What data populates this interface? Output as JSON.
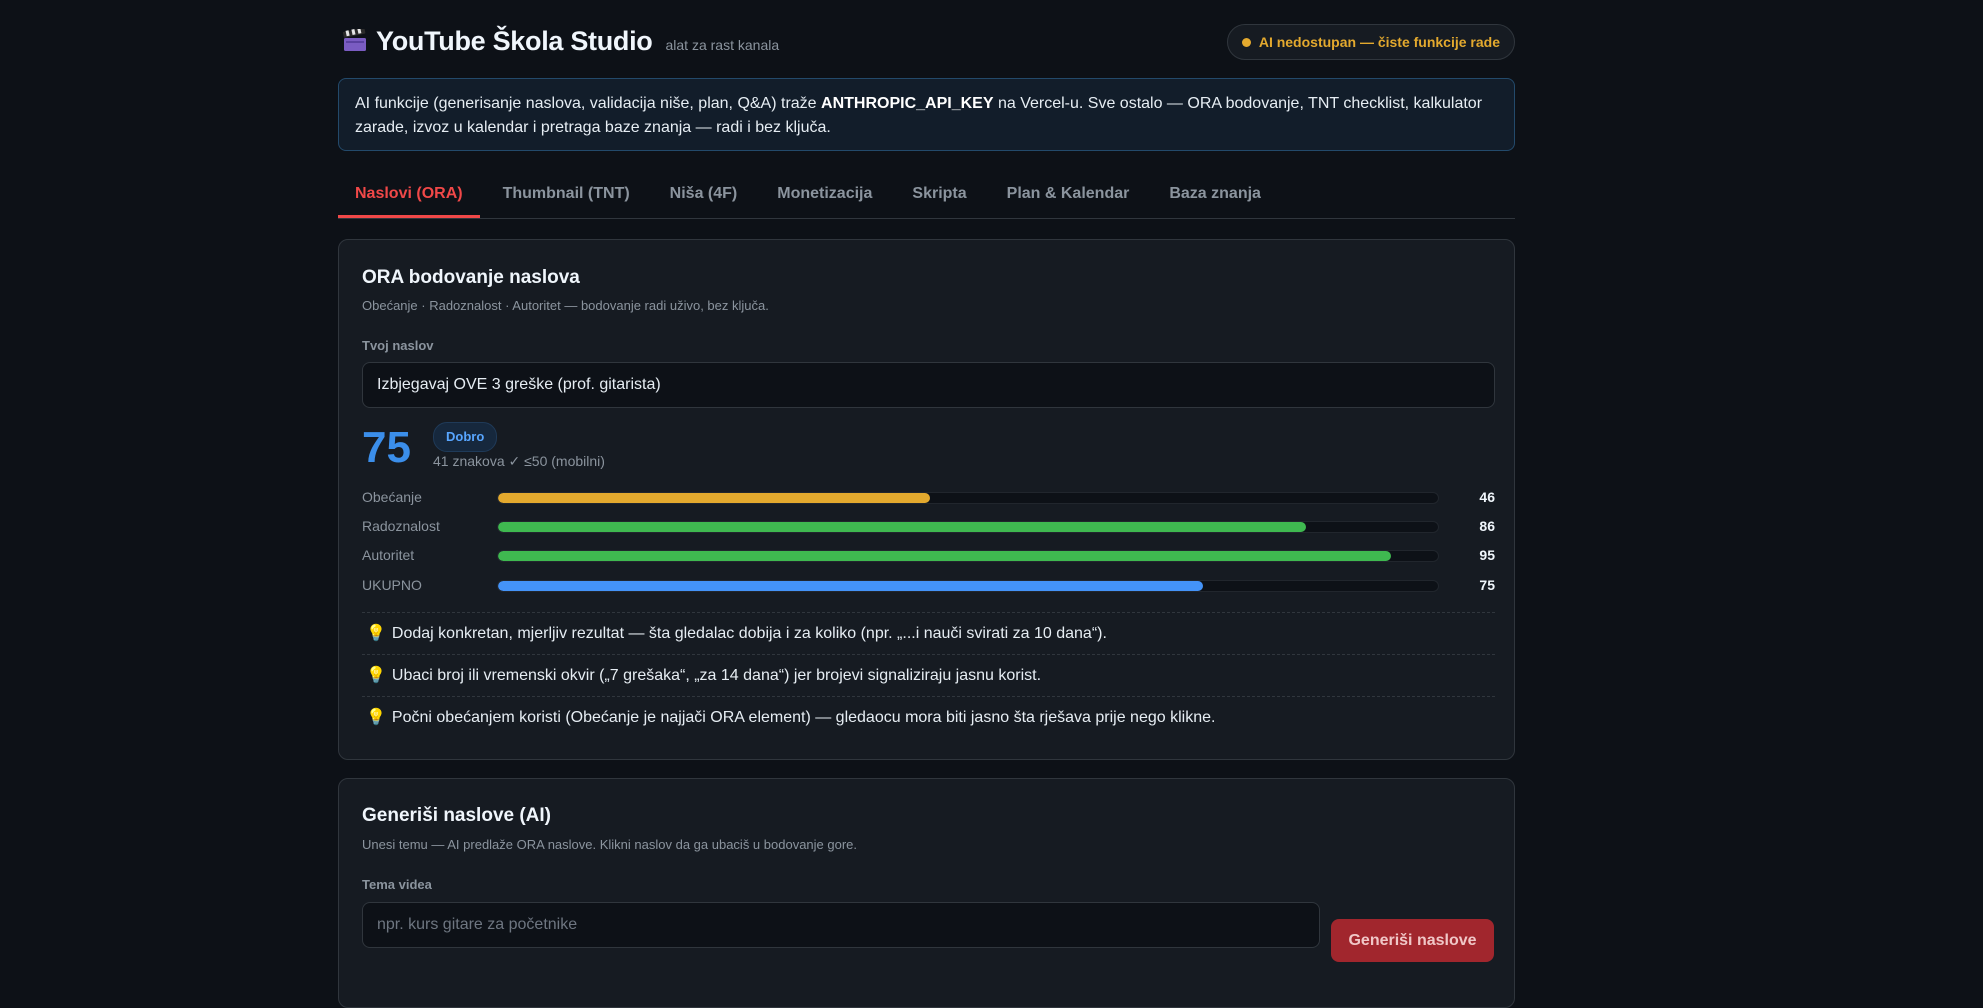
{
  "header": {
    "icon": "clapperboard-icon",
    "title": "YouTube Škola Studio",
    "subtitle": "alat za rast kanala",
    "status": "AI nedostupan — čiste funkcije rade",
    "status_color": "#e3a92e"
  },
  "notice": {
    "part1": "AI funkcije (generisanje naslova, validacija niše, plan, Q&A) traže ",
    "key": "ANTHROPIC_API_KEY",
    "part2": " na Vercel-u. Sve ostalo — ORA bodovanje, TNT checklist, kalkulator zarade, izvoz u kalendar i pretraga baze znanja — radi i bez ključa."
  },
  "tabs": [
    {
      "label": "Naslovi (ORA)",
      "active": true
    },
    {
      "label": "Thumbnail (TNT)",
      "active": false
    },
    {
      "label": "Niša (4F)",
      "active": false
    },
    {
      "label": "Monetizacija",
      "active": false
    },
    {
      "label": "Skripta",
      "active": false
    },
    {
      "label": "Plan & Kalendar",
      "active": false
    },
    {
      "label": "Baza znanja",
      "active": false
    }
  ],
  "ora": {
    "title": "ORA bodovanje naslova",
    "desc": "Obećanje · Radoznalost · Autoritet — bodovanje radi uživo, bez ključa.",
    "field_label": "Tvoj naslov",
    "input_value": "Izbjegavaj OVE 3 greške (prof. gitarista)",
    "score": "75",
    "badge": "Dobro",
    "char_count": "41 znakova ✓ ≤50 (mobilni)",
    "bars": [
      {
        "label": "Obećanje",
        "value": 46,
        "color": "#e3a92e"
      },
      {
        "label": "Radoznalost",
        "value": 86,
        "color": "#3fb950"
      },
      {
        "label": "Autoritet",
        "value": 95,
        "color": "#3fb950"
      },
      {
        "label": "UKUPNO",
        "value": 75,
        "color": "#4493f8"
      }
    ],
    "tips": [
      "Dodaj konkretan, mjerljiv rezultat — šta gledalac dobija i za koliko (npr. „...i nauči svirati za 10 dana“).",
      "Ubaci broj ili vremenski okvir („7 grešaka“, „za 14 dana“) jer brojevi signaliziraju jasnu korist.",
      "Počni obećanjem koristi (Obećanje je najjači ORA element) — gledaocu mora biti jasno šta rješava prije nego klikne."
    ],
    "tip_icon": "lightbulb-icon"
  },
  "gen": {
    "title": "Generiši naslove (AI)",
    "desc": "Unesi temu — AI predlaže ORA naslove. Klikni naslov da ga ubaciš u bodovanje gore.",
    "field_label": "Tema videa",
    "placeholder": "npr. kurs gitare za početnike",
    "button": "Generiši naslove"
  }
}
